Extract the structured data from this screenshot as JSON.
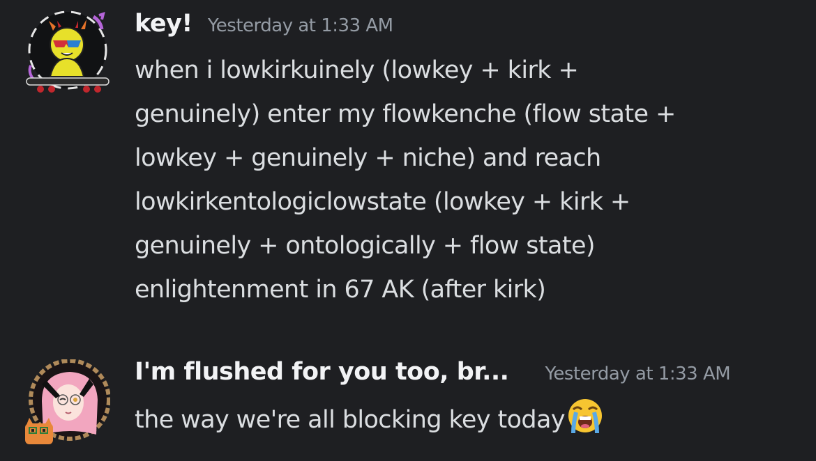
{
  "messages": [
    {
      "author": "key!",
      "timestamp": "Yesterday at 1:33 AM",
      "lines": [
        "when i lowkirkuinely (lowkey + kirk +",
        "genuinely) enter my flowkenche (flow state +",
        "lowkey + genuinely + niche) and reach",
        "lowkirkentologiclowstate (lowkey + kirk +",
        "genuinely + ontologically + flow state)",
        "enlightenment in 67 AK (after kirk)"
      ],
      "avatar_icon": "skateboard-character-avatar"
    },
    {
      "author": "I'm flushed for you too, br...",
      "timestamp": "Yesterday at 1:33 AM",
      "text": "the way we're all blocking key today",
      "emoji": "loudly-crying-face-emoji",
      "avatar_icon": "pink-hair-girl-cat-avatar"
    }
  ],
  "colors": {
    "background": "#1e1f22",
    "username": "#f2f3f5",
    "timestamp": "#949ba4",
    "text": "#dbdee1"
  }
}
